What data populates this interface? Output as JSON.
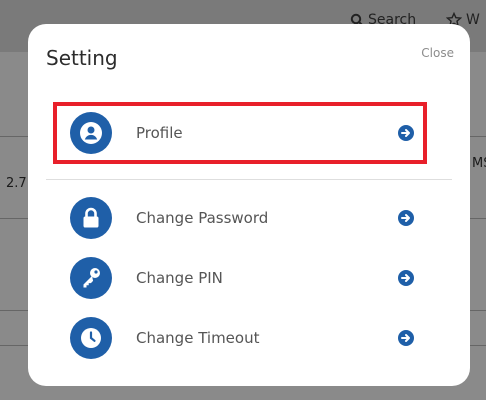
{
  "background": {
    "search_label": "Search",
    "w_label": "W",
    "left_number": "2.7",
    "right_text": "MS"
  },
  "modal": {
    "title": "Setting",
    "close_label": "Close",
    "items": [
      {
        "label": "Profile",
        "icon": "user-circle-icon"
      },
      {
        "label": "Change Password",
        "icon": "lock-icon"
      },
      {
        "label": "Change PIN",
        "icon": "key-icon"
      },
      {
        "label": "Change Timeout",
        "icon": "clock-icon"
      }
    ]
  },
  "colors": {
    "accent": "#1f5fa8",
    "highlight": "#e8202a"
  }
}
